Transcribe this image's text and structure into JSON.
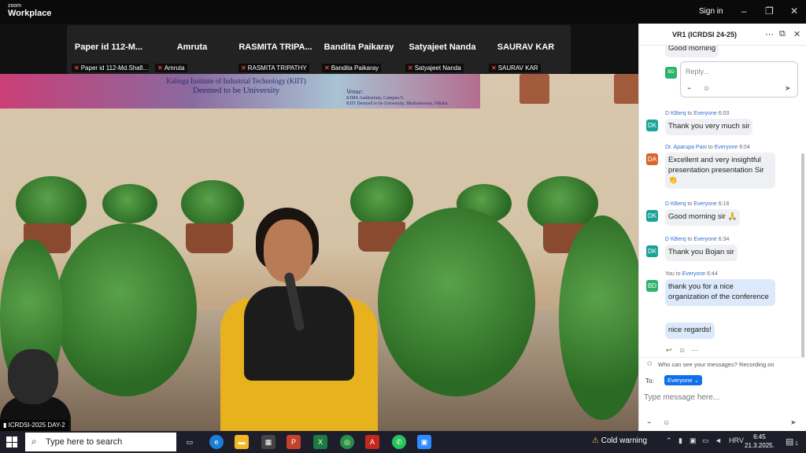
{
  "titlebar": {
    "brand_small": "zoom",
    "brand_big": "Workplace",
    "sign_in": "Sign in",
    "minimize_glyph": "–",
    "restore_glyph": "❐",
    "close_glyph": "✕"
  },
  "thumbnails": [
    {
      "name": "Paper id 112-M...",
      "label": "Paper id 112-Md.Shafi..."
    },
    {
      "name": "Amruta",
      "label": "Amruta"
    },
    {
      "name": "RASMITA TRIPA...",
      "label": "RASMITA TRIPATHY"
    },
    {
      "name": "Bandita Paikaray",
      "label": "Bandita Paikaray"
    },
    {
      "name": "Satyajeet Nanda",
      "label": "Satyajeet Nanda"
    },
    {
      "name": "SAURAV KAR",
      "label": "SAURAV KAR"
    }
  ],
  "stage": {
    "banner_line1": "Kalinga Institute of Industrial Technology (KIIT)",
    "banner_line2": "Deemed to be University",
    "banner_venue": "Venue:",
    "banner_venue1": "KIMS Auditorium, Campus-5,",
    "banner_venue2": "KIIT Deemed to be University, Bhubaneswar, Odisha",
    "meeting_label": "ICRDSI-2025 DAY-2"
  },
  "chat": {
    "title": "VR1 (ICRDSI 24-25)",
    "top_message": "Good morning",
    "reply_avatar": "BD",
    "reply_placeholder": "Reply...",
    "messages": [
      {
        "initials": "DK",
        "color": "#1aa39a",
        "sender": "D KBerq",
        "to": "to",
        "target": "Everyone",
        "time": "6:03",
        "text": "Thank you very much sir"
      },
      {
        "initials": "DA",
        "color": "#d9662b",
        "sender": "Dr. Aparupa Pani",
        "to": "to",
        "target": "Everyone",
        "time": "6:04",
        "text": "Excellent and very insightful presentation presentation Sir 👏"
      },
      {
        "initials": "DK",
        "color": "#1aa39a",
        "sender": "D KBerq",
        "to": "to",
        "target": "Everyone",
        "time": "6:16",
        "text": "Good morning sir 🙏"
      },
      {
        "initials": "DK",
        "color": "#1aa39a",
        "sender": "D KBerq",
        "to": "to",
        "target": "Everyone",
        "time": "6:34",
        "text": "Thank you Bojan sir"
      },
      {
        "initials": "BD",
        "color": "#2bb36a",
        "sender": "You",
        "to": "to",
        "target": "Everyone",
        "time": "6:44",
        "text": "thank you for a nice organization of the conference",
        "text2": "nice regards!"
      }
    ],
    "notice": "Who can see your messages? Recording on",
    "to_label": "To:",
    "to_value": "Everyone",
    "input_placeholder": "Type message here..."
  },
  "taskbar": {
    "search_placeholder": "Type here to search",
    "weather": "Cold warning",
    "language": "HRV",
    "time": "6:45",
    "date": "21.3.2025.",
    "notification_count": "1"
  }
}
